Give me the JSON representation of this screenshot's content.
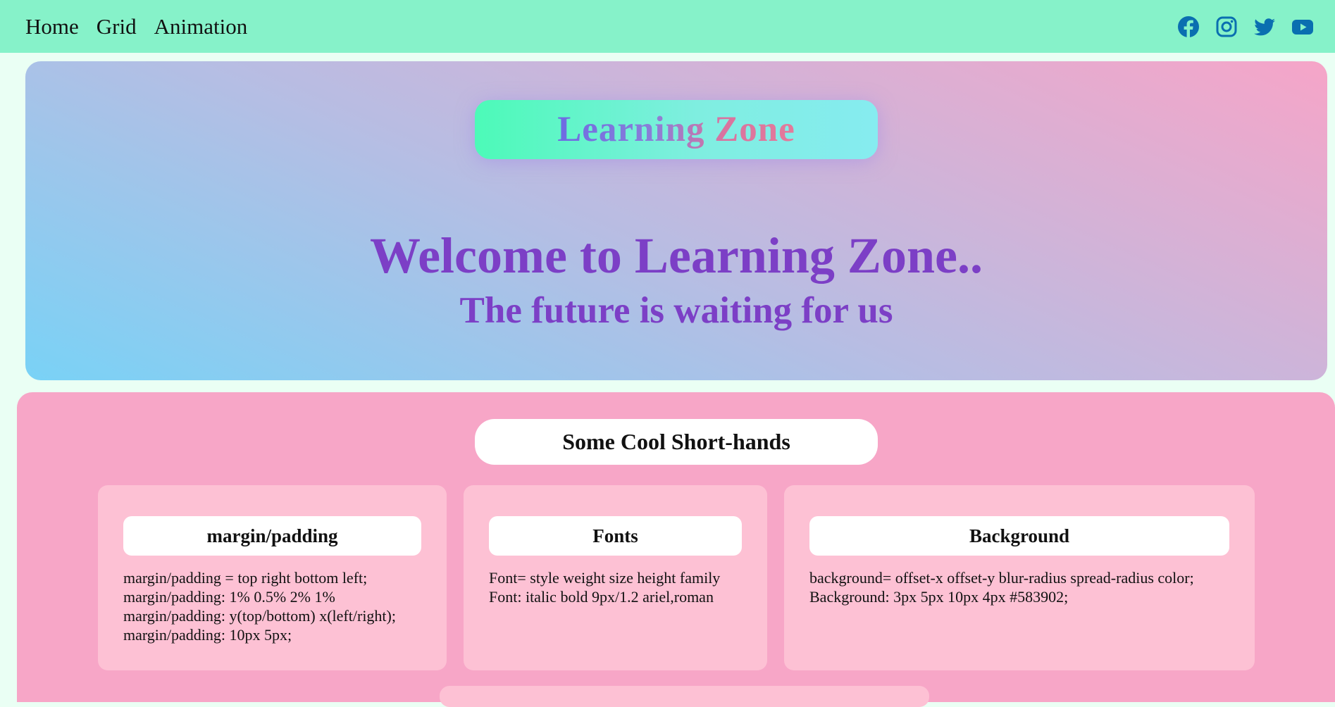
{
  "nav": {
    "links": [
      "Home",
      "Grid",
      "Animation"
    ],
    "icons": [
      "facebook-icon",
      "instagram-icon",
      "twitter-icon",
      "youtube-icon"
    ],
    "icon_color": "#0a6fb0",
    "background": "#86f2c9"
  },
  "hero": {
    "brand": "Learning Zone",
    "heading": "Welcome to Learning Zone..",
    "subheading": "The future is waiting for us",
    "text_color": "#7c3fc6"
  },
  "shorthands": {
    "title": "Some Cool Short-hands",
    "background": "#f7a6c7",
    "cards": [
      {
        "title": "margin/padding",
        "lines": [
          "margin/padding = top right bottom left;",
          "margin/padding: 1% 0.5% 2% 1%",
          "margin/padding: y(top/bottom) x(left/right);",
          "margin/padding: 10px 5px;"
        ]
      },
      {
        "title": "Fonts",
        "lines": [
          "Font= style weight size height family",
          "Font: italic bold 9px/1.2 ariel,roman"
        ]
      },
      {
        "title": "Background",
        "lines": [
          "background= offset-x offset-y blur-radius spread-radius color;",
          "Background: 3px 5px 10px 4px #583902;"
        ]
      }
    ]
  }
}
